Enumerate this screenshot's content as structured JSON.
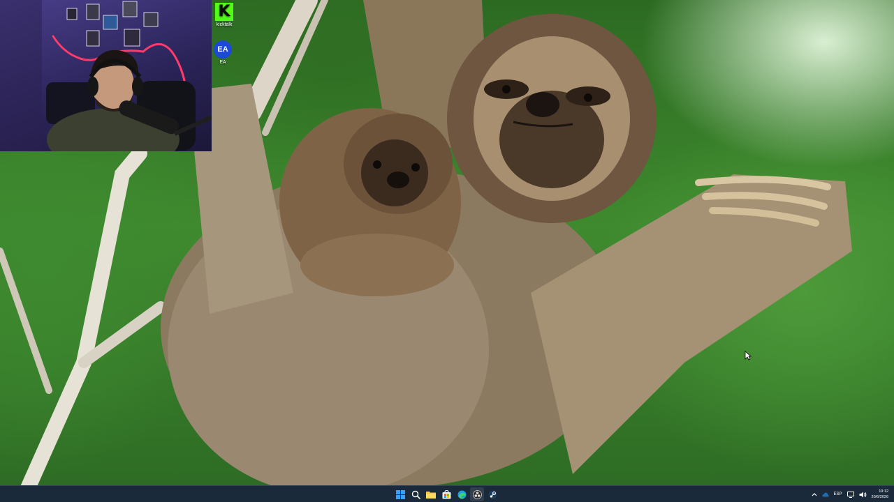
{
  "desktop": {
    "icons": [
      {
        "label": "kicktalk",
        "icon": "kick-icon",
        "glyph": "K"
      },
      {
        "label": "EA",
        "icon": "ea-icon",
        "glyph": "EA"
      }
    ]
  },
  "webcam": {
    "content": "streamer-webcam"
  },
  "taskbar": {
    "pinned": [
      {
        "name": "start-button",
        "icon": "windows-icon"
      },
      {
        "name": "search-button",
        "icon": "search-icon"
      },
      {
        "name": "file-explorer-button",
        "icon": "folder-icon"
      },
      {
        "name": "store-button",
        "icon": "store-icon"
      },
      {
        "name": "edge-button",
        "icon": "edge-icon"
      },
      {
        "name": "obs-button",
        "icon": "obs-icon"
      },
      {
        "name": "steam-button",
        "icon": "steam-icon"
      }
    ],
    "tray": {
      "language": "ESP",
      "time": "19:12",
      "date": "20/6/2026"
    }
  },
  "colors": {
    "taskbar_bg": "#1b2a3a",
    "kick_green": "#53fc18",
    "ea_blue": "#1c49d6",
    "windows_blue": "#3aa0ff"
  }
}
